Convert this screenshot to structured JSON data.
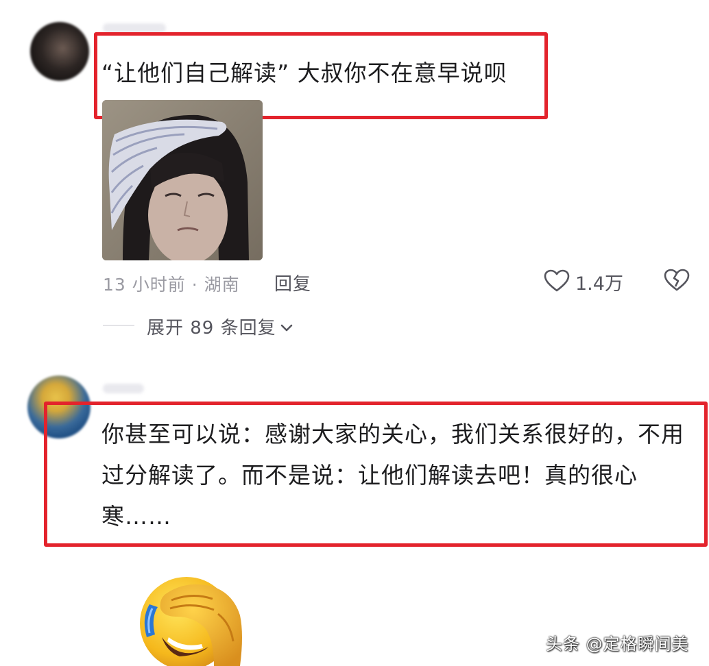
{
  "comments": [
    {
      "text": "“让他们自己解读” 大叔你不在意早说呗",
      "meta": "13 小时前 · 湖南",
      "reply_label": "回复",
      "likes": "1.4万",
      "expand_label": "展开 89 条回复"
    },
    {
      "text": "你甚至可以说：感谢大家的关心，我们关系很好的，不用过分解读了。而不是说：让他们解读去吧！真的很心寒……"
    }
  ],
  "watermark": "头条 @定格瞬间美",
  "colors": {
    "highlight_box": "#e3232c",
    "meta_text": "#9a9aa2",
    "body_text": "#1d1d1f"
  },
  "icons": [
    "heart-icon",
    "heart-broken-icon",
    "chevron-down-icon",
    "facepalm-emoji"
  ]
}
